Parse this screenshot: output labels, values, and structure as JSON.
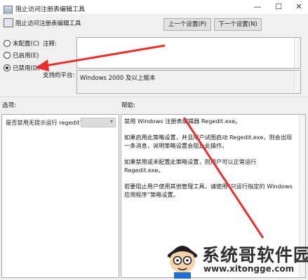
{
  "window": {
    "title": "阻止访问注册表编辑工具",
    "minimize": "—",
    "restore": "☐",
    "close": "✕"
  },
  "header": {
    "policy_name": "阻止访问注册表编辑工具",
    "prev_button": "上一个设置(P)",
    "next_button": "下一个设置(N)"
  },
  "options_radio": [
    {
      "label": "未配置(C)",
      "selected": false
    },
    {
      "label": "已启用(E)",
      "selected": false
    },
    {
      "label": "已禁用(D)",
      "selected": true
    }
  ],
  "comment_label": "注释:",
  "supported_label": "支持的平台:",
  "supported_value": "Windows 2000 及以上版本",
  "options_label": "选项:",
  "help_label": "帮助:",
  "option_item": "是否禁用无提示运行 regedit?",
  "help_paragraphs": [
    "禁用 Windows 注册表编辑器 Regedit.exe。",
    "如果启用此策略设置，并且用户试图启动 Regedit.exe，则会出现一条消息，说明策略设置会阻止此操作。",
    "如果禁用或未配置此策略设置，则用户可以正常运行 Regedit.exe。",
    "若要阻止用户使用其他管理工具，请使用“只运行指定的 Windows 应用程序”策略设置。"
  ],
  "watermark": {
    "text": "系统哥软件园",
    "url": "www.xitongge.com"
  },
  "colors": {
    "arrow": "#e8312f",
    "window_bg": "#f0f0f0",
    "box_bg": "#ffffff"
  }
}
